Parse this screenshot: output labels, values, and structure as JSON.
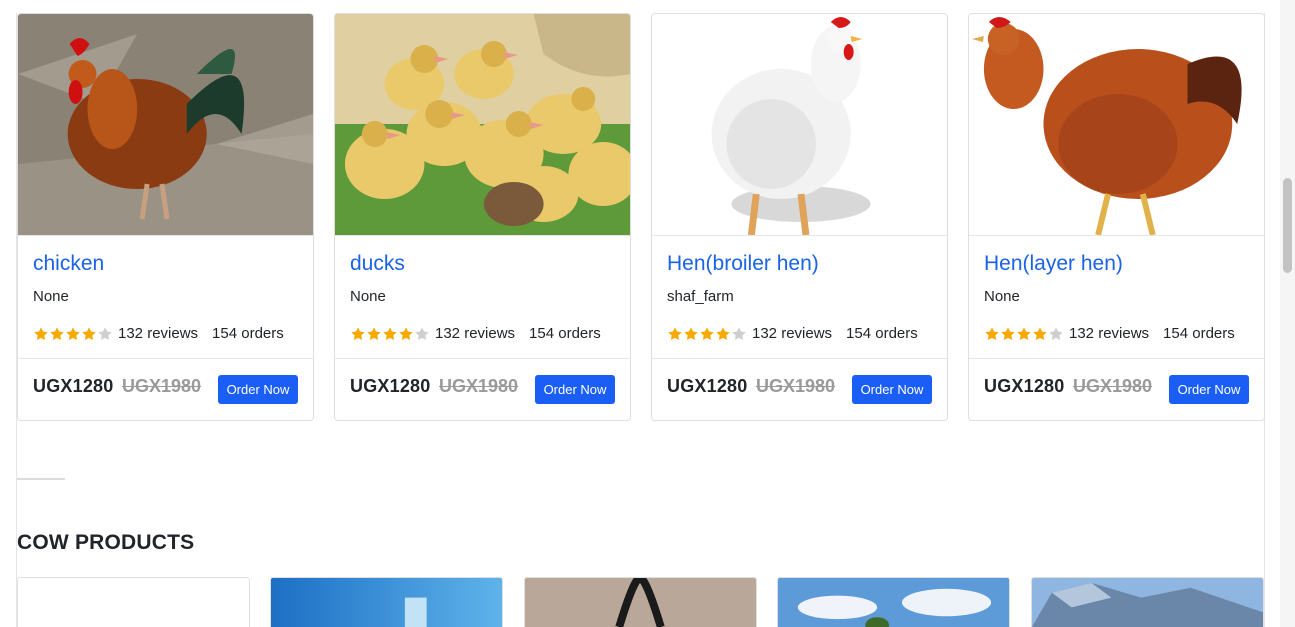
{
  "products": [
    {
      "title": "chicken",
      "seller": "None",
      "reviews": "132 reviews",
      "orders": "154 orders",
      "price": "UGX1280",
      "old_price": "UGX1980",
      "button": "Order Now",
      "rating": 4,
      "image": "rooster-photo"
    },
    {
      "title": "ducks",
      "seller": "None",
      "reviews": "132 reviews",
      "orders": "154 orders",
      "price": "UGX1280",
      "old_price": "UGX1980",
      "button": "Order Now",
      "rating": 4,
      "image": "ducklings-photo"
    },
    {
      "title": "Hen(broiler hen)",
      "seller": "shaf_farm",
      "reviews": "132 reviews",
      "orders": "154 orders",
      "price": "UGX1280",
      "old_price": "UGX1980",
      "button": "Order Now",
      "rating": 4,
      "image": "white-hen-photo"
    },
    {
      "title": "Hen(layer hen)",
      "seller": "None",
      "reviews": "132 reviews",
      "orders": "154 orders",
      "price": "UGX1280",
      "old_price": "UGX1980",
      "button": "Order Now",
      "rating": 4,
      "image": "brown-hen-photo"
    }
  ],
  "section": {
    "title": "COW PRODUCTS"
  },
  "colors": {
    "accent": "#1a5ef5",
    "title": "#1a62e6",
    "star": "#f7a900",
    "star_empty": "#cfcfcf",
    "old_price": "#9a9a9a"
  }
}
